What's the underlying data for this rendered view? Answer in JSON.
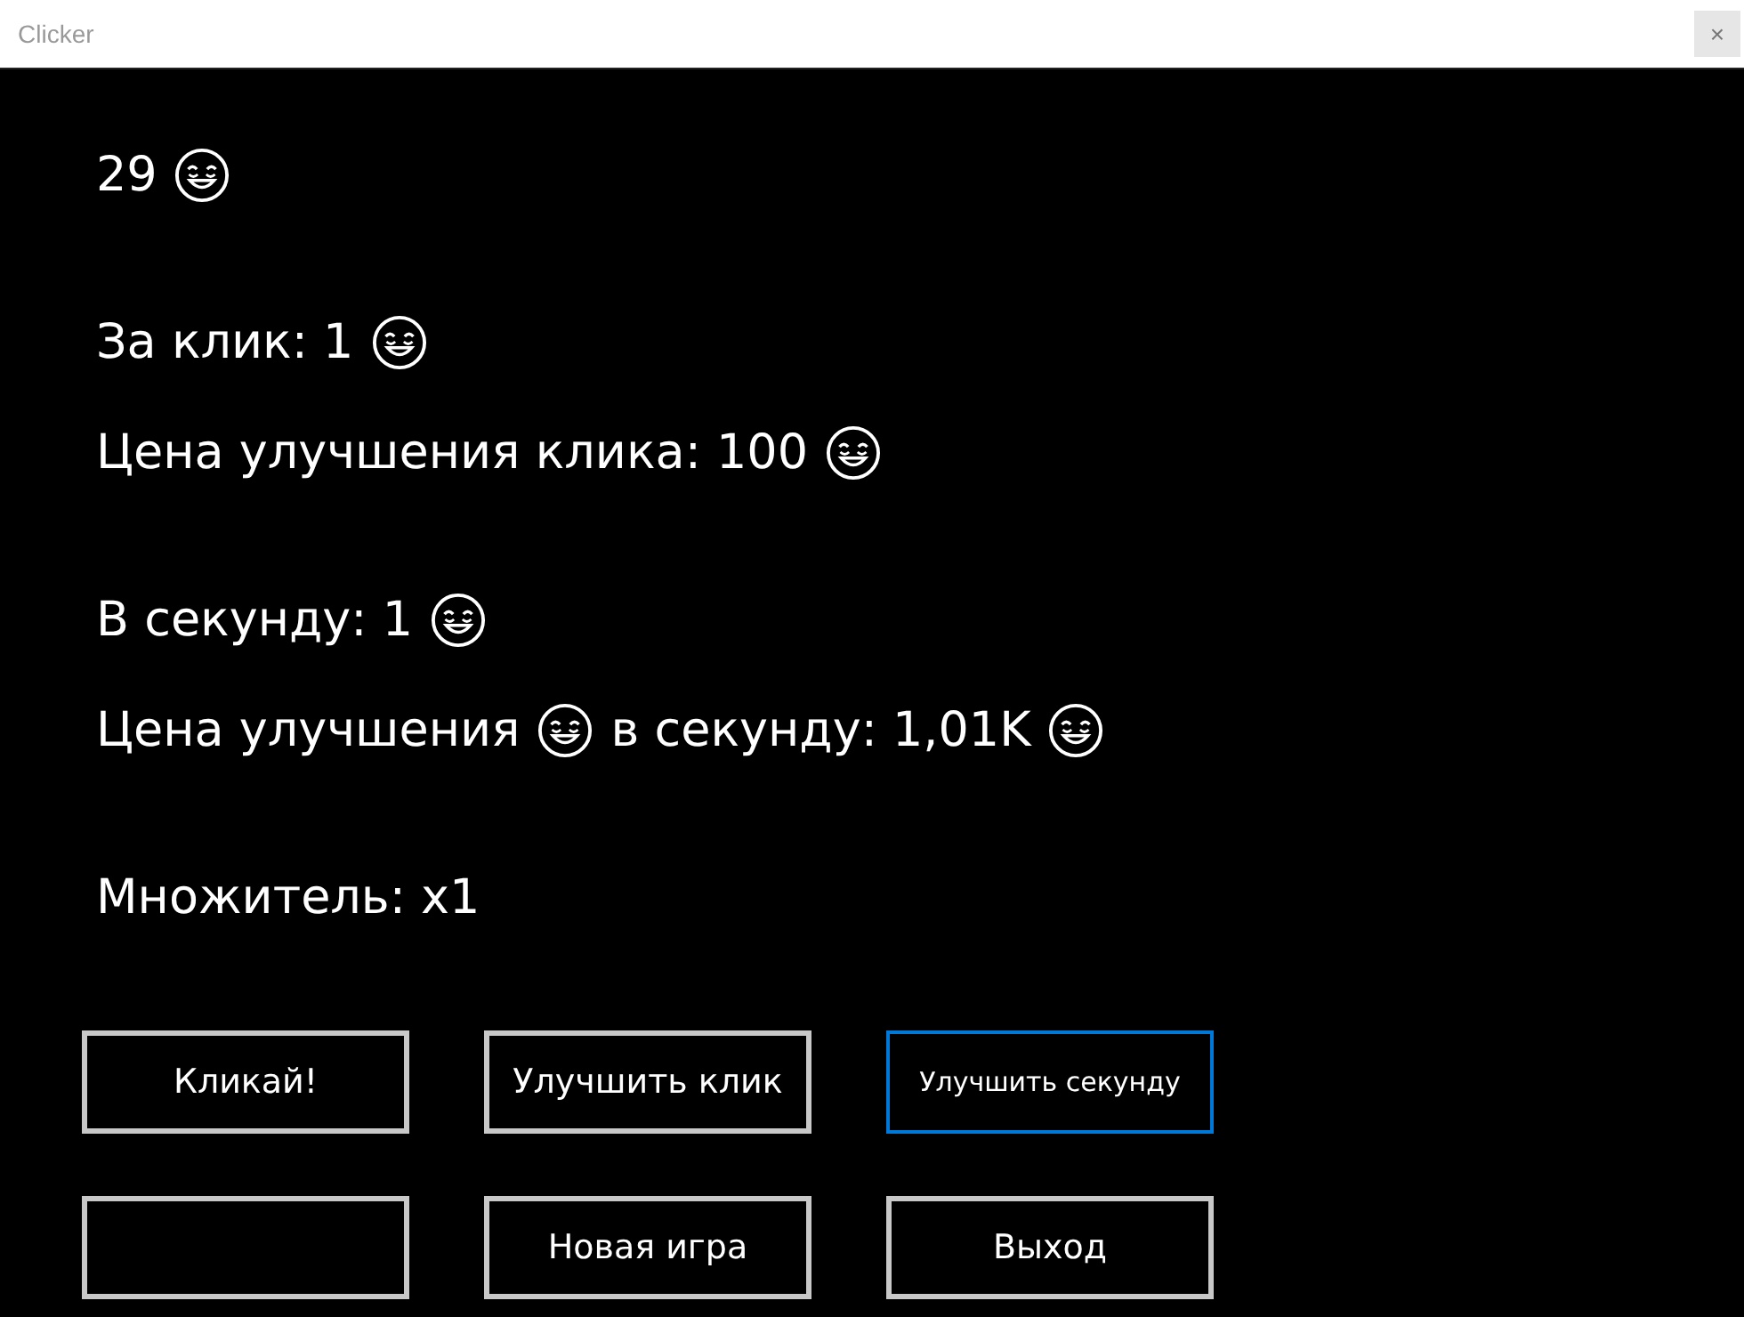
{
  "window": {
    "title": "Clicker",
    "close": {
      "label": "×",
      "disabled": true
    }
  },
  "groups": [
    {
      "lines": [
        [
          {
            "kind": "text",
            "text": "29"
          },
          {
            "kind": "emoji"
          }
        ]
      ]
    },
    {
      "lines": [
        [
          {
            "kind": "text",
            "text": "За клик: 1"
          },
          {
            "kind": "emoji"
          }
        ],
        [
          {
            "kind": "text",
            "text": "Цена улучшения клика: 100"
          },
          {
            "kind": "emoji"
          }
        ]
      ]
    },
    {
      "lines": [
        [
          {
            "kind": "text",
            "text": "В секунду: 1"
          },
          {
            "kind": "emoji"
          }
        ],
        [
          {
            "kind": "text",
            "text": "Цена улучшения"
          },
          {
            "kind": "emoji"
          },
          {
            "kind": "text",
            "text": "в секунду: 1,01K"
          },
          {
            "kind": "emoji"
          }
        ]
      ]
    },
    {
      "lines": [
        [
          {
            "kind": "text",
            "text": "Множитель: x1"
          }
        ]
      ]
    }
  ],
  "buttons": [
    {
      "label": "Кликай!",
      "focused": false
    },
    {
      "label": "Улучшить клик",
      "focused": false
    },
    {
      "label": "Улучшить секунду",
      "focused": true
    },
    {
      "focused": false
    },
    {
      "label": "Новая игра",
      "focused": false
    },
    {
      "label": "Выход",
      "focused": false
    }
  ]
}
